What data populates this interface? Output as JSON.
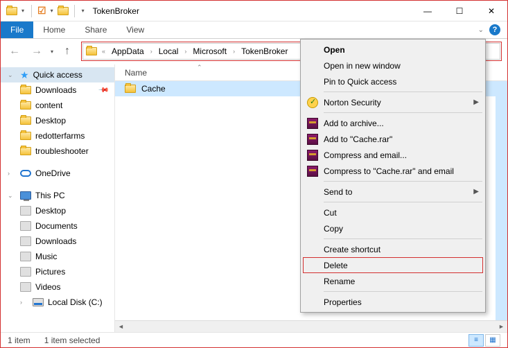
{
  "window_title": "TokenBroker",
  "ribbon_tabs": {
    "file": "File",
    "home": "Home",
    "share": "Share",
    "view": "View"
  },
  "breadcrumbs": [
    "AppData",
    "Local",
    "Microsoft",
    "TokenBroker"
  ],
  "column_header": "Name",
  "sidebar": {
    "quick_access": "Quick access",
    "items": [
      "Downloads",
      "content",
      "Desktop",
      "redotterfarms",
      "troubleshooter"
    ],
    "onedrive": "OneDrive",
    "this_pc": "This PC",
    "pc_items": [
      "Desktop",
      "Documents",
      "Downloads",
      "Music",
      "Pictures",
      "Videos",
      "Local Disk (C:)"
    ]
  },
  "files": [
    {
      "name": "Cache",
      "selected": true
    }
  ],
  "context_menu": {
    "open": "Open",
    "open_new": "Open in new window",
    "pin_quick": "Pin to Quick access",
    "norton": "Norton Security",
    "add_archive": "Add to archive...",
    "add_cache": "Add to \"Cache.rar\"",
    "compress_email": "Compress and email...",
    "compress_cache": "Compress to \"Cache.rar\" and email",
    "send_to": "Send to",
    "cut": "Cut",
    "copy": "Copy",
    "shortcut": "Create shortcut",
    "delete": "Delete",
    "rename": "Rename",
    "properties": "Properties"
  },
  "statusbar": {
    "count": "1 item",
    "selected": "1 item selected"
  }
}
